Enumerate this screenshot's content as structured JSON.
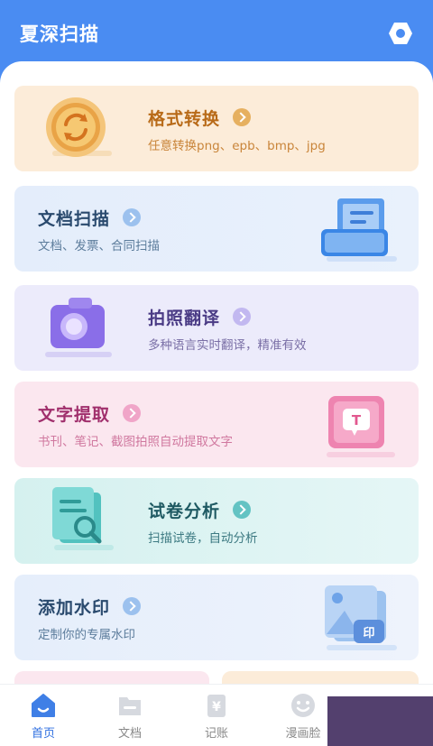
{
  "header": {
    "title": "夏深扫描",
    "settings_icon": "hexagon-gear-icon"
  },
  "colors": {
    "primary": "#4a8cf2",
    "active_tab": "#2f6fe0"
  },
  "cards": [
    {
      "title": "格式转换",
      "desc": "任意转换png、epb、bmp、jpg",
      "icon": "sync-coin-icon",
      "title_color": "#b86a18",
      "desc_color": "#c9853a",
      "arrow_color": "#e6b060"
    },
    {
      "title": "文档扫描",
      "desc": "文档、发票、合同扫描",
      "icon": "scanner-icon",
      "title_color": "#2a4a6e",
      "desc_color": "#5d7d9c",
      "arrow_color": "#9cc1ee"
    },
    {
      "title": "拍照翻译",
      "desc": "多种语言实时翻译，精准有效",
      "icon": "camera-icon",
      "title_color": "#4a3b85",
      "desc_color": "#7a6fa6",
      "arrow_color": "#c2b8f0"
    },
    {
      "title": "文字提取",
      "desc": "书刊、笔记、截图拍照自动提取文字",
      "icon": "text-bubble-icon",
      "title_color": "#a02f6c",
      "desc_color": "#d0789f",
      "arrow_color": "#f0a5c8"
    },
    {
      "title": "试卷分析",
      "desc": "扫描试卷，自动分析",
      "icon": "paper-search-icon",
      "title_color": "#1f5a63",
      "desc_color": "#3d7a82",
      "arrow_color": "#63c3c3"
    },
    {
      "title": "添加水印",
      "desc": "定制你的专属水印",
      "icon": "watermark-image-icon",
      "title_color": "#2a4a6e",
      "desc_color": "#5d7d9c",
      "arrow_color": "#9cc1ee"
    }
  ],
  "tabs": [
    {
      "label": "首页",
      "icon": "home-icon",
      "active": true
    },
    {
      "label": "文档",
      "icon": "folder-icon",
      "active": false
    },
    {
      "label": "记账",
      "icon": "yen-ledger-icon",
      "active": false
    },
    {
      "label": "漫画脸",
      "icon": "smiley-face-icon",
      "active": false
    }
  ]
}
